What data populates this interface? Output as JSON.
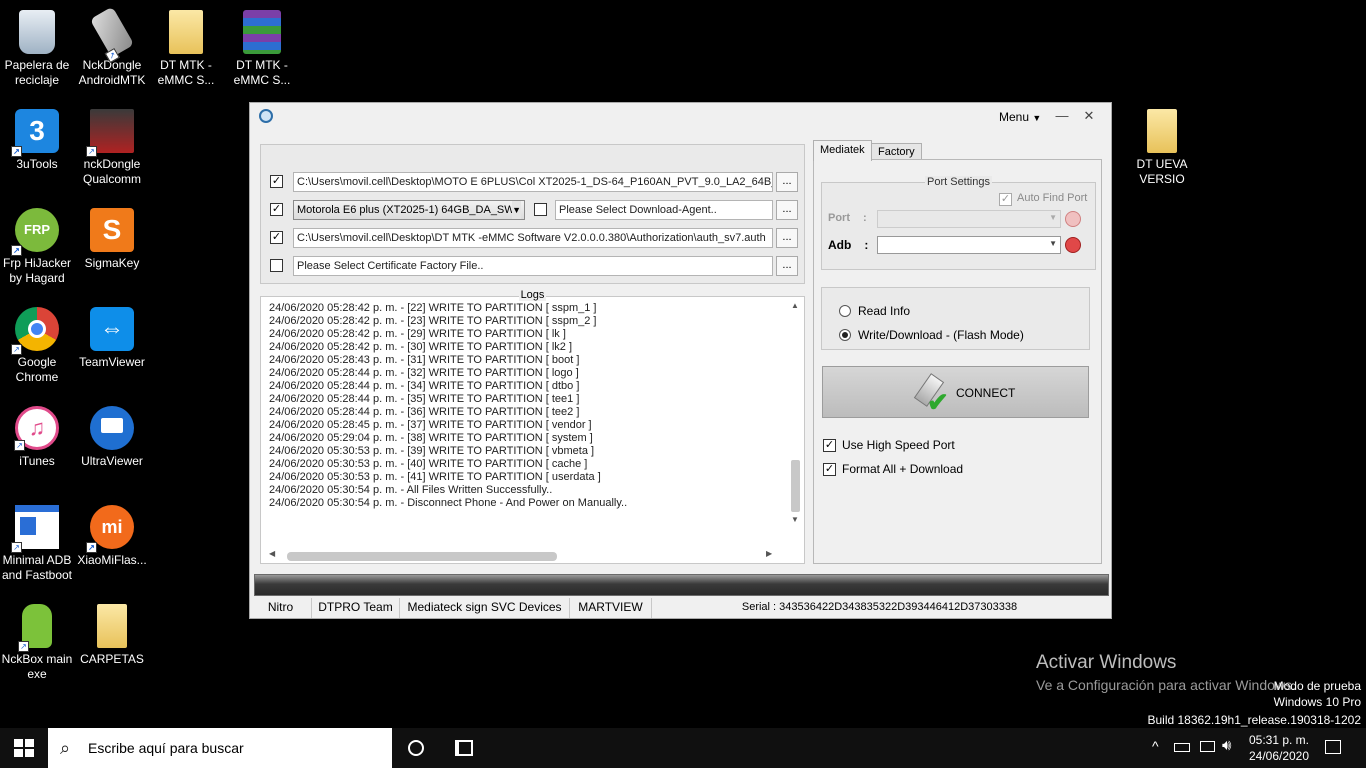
{
  "desktop": {
    "icons": [
      {
        "label": "Papelera de reciclaje",
        "icon": "recycle-bin-icon"
      },
      {
        "label": "NckDongle AndroidMTK",
        "icon": "phone-tool-icon"
      },
      {
        "label": "DT MTK -eMMC S...",
        "icon": "folder-icon"
      },
      {
        "label": "DT MTK -eMMC S...",
        "icon": "winrar-icon"
      },
      {
        "label": "3uTools",
        "icon": "3utools-icon"
      },
      {
        "label": "nckDongle Qualcomm",
        "icon": "nck-qualcomm-icon"
      },
      {
        "label": "Frp HiJacker by Hagard",
        "icon": "frp-icon"
      },
      {
        "label": "SigmaKey",
        "icon": "sigmakey-icon"
      },
      {
        "label": "Google Chrome",
        "icon": "chrome-icon"
      },
      {
        "label": "TeamViewer",
        "icon": "teamviewer-icon"
      },
      {
        "label": "iTunes",
        "icon": "itunes-icon"
      },
      {
        "label": "UltraViewer",
        "icon": "ultraviewer-icon"
      },
      {
        "label": "Minimal ADB and Fastboot",
        "icon": "adb-icon"
      },
      {
        "label": "XiaoMiFlas...",
        "icon": "xiaomi-icon"
      },
      {
        "label": "NckBox main exe",
        "icon": "android-icon"
      },
      {
        "label": "CARPETAS",
        "icon": "folder-icon"
      },
      {
        "label": "DT UEVA VERSIO",
        "icon": "folder-icon"
      }
    ]
  },
  "app": {
    "menu_label": "Menu",
    "minimize": "—",
    "close": "✕",
    "files": {
      "row1_path": "C:\\Users\\movil.cell\\Desktop\\MOTO E 6PLUS\\Col XT2025-1_DS-64_P160AN_PVT_9.0_LA2_64B_",
      "row2_model": "Motorola E6 plus (XT2025-1) 64GB_DA_SW",
      "row2_agent": "Please Select Download-Agent..",
      "row3_auth": "C:\\Users\\movil.cell\\Desktop\\DT MTK -eMMC Software V2.0.0.0.380\\Authorization\\auth_sv7.auth",
      "row4_cert": "Please Select Certificate Factory File..",
      "browse": "..."
    },
    "logs": {
      "title": "Logs",
      "lines": [
        "24/06/2020 05:28:42 p. m. - [22] WRITE TO PARTITION [ sspm_1 ]",
        "24/06/2020 05:28:42 p. m. - [23] WRITE TO PARTITION [ sspm_2 ]",
        "24/06/2020 05:28:42 p. m. - [29] WRITE TO PARTITION [ lk ]",
        "24/06/2020 05:28:42 p. m. - [30] WRITE TO PARTITION [ lk2 ]",
        "24/06/2020 05:28:43 p. m. - [31] WRITE TO PARTITION [ boot ]",
        "24/06/2020 05:28:44 p. m. - [32] WRITE TO PARTITION [ logo ]",
        "24/06/2020 05:28:44 p. m. - [34] WRITE TO PARTITION [ dtbo ]",
        "24/06/2020 05:28:44 p. m. - [35] WRITE TO PARTITION [ tee1 ]",
        "24/06/2020 05:28:44 p. m. - [36] WRITE TO PARTITION [ tee2 ]",
        "24/06/2020 05:28:45 p. m. - [37] WRITE TO PARTITION [ vendor ]",
        "24/06/2020 05:29:04 p. m. - [38] WRITE TO PARTITION [ system ]",
        "24/06/2020 05:30:53 p. m. - [39] WRITE TO PARTITION [ vbmeta ]",
        "24/06/2020 05:30:53 p. m. - [40] WRITE TO PARTITION [ cache ]",
        "24/06/2020 05:30:53 p. m. - [41] WRITE TO PARTITION [ userdata ]",
        "24/06/2020 05:30:54 p. m. - All Files Written Successfully..",
        "24/06/2020 05:30:54 p. m. - Disconnect Phone - And Power on Manually.."
      ]
    },
    "tabs": [
      "Mediatek",
      "Factory"
    ],
    "port_settings": {
      "title": "Port Settings",
      "auto_find": "Auto Find Port",
      "port_label": "Port",
      "adb_label": "Adb",
      "colon": ":"
    },
    "modes": {
      "read_info": "Read Info",
      "write_download": "Write/Download - (Flash Mode)"
    },
    "connect_label": "CONNECT",
    "options": {
      "high_speed": "Use High Speed Port",
      "format_all": "Format All + Download"
    },
    "status_bar": {
      "nitro": "Nitro",
      "dtpro": "DTPRO Team",
      "mediateck": "Mediateck sign SVC Devices",
      "martview": "MARTVIEW",
      "serial": "Serial : 343536422D343835322D393446412D37303338"
    }
  },
  "watermark": {
    "activate_title": "Activar Windows",
    "activate_sub": "Ve a Configuración para activar Windows.",
    "test_mode": "Modo de prueba",
    "edition": "Windows 10 Pro",
    "build": "Build 18362.19h1_release.190318-1202"
  },
  "taskbar": {
    "search_placeholder": "Escribe aquí para buscar",
    "time": "05:31 p. m.",
    "date": "24/06/2020"
  }
}
